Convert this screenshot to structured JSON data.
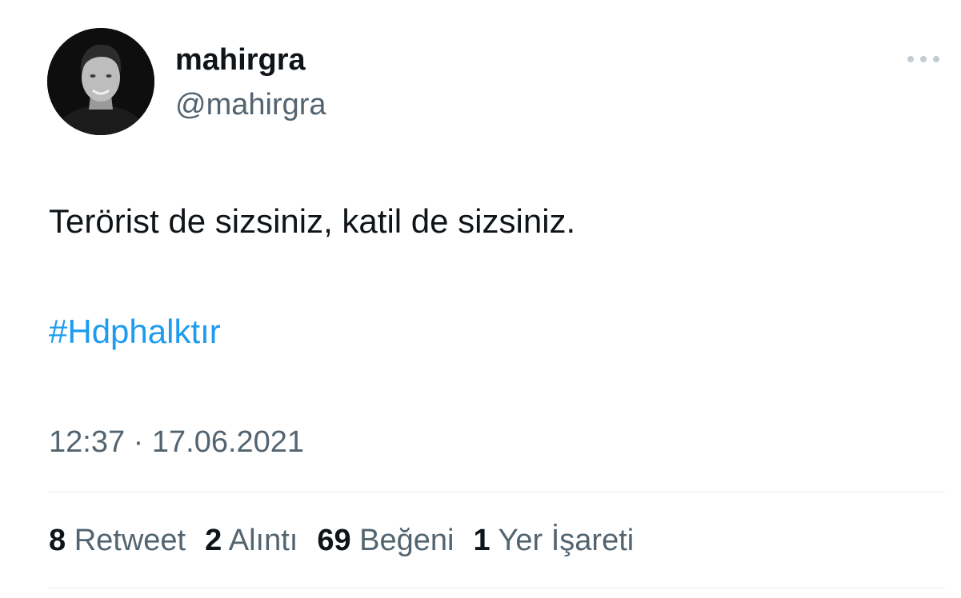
{
  "author": {
    "display_name": "mahirgra",
    "handle": "@mahirgra",
    "avatar_icon": "profile-photo"
  },
  "tweet": {
    "text": "Terörist de sizsiniz, katil de sizsiniz.",
    "hashtag": "#Hdphalktır",
    "timestamp": "12:37 · 17.06.2021"
  },
  "stats": [
    {
      "count": "8",
      "label": "Retweet"
    },
    {
      "count": "2",
      "label": "Alıntı"
    },
    {
      "count": "69",
      "label": "Beğeni"
    },
    {
      "count": "1",
      "label": "Yer İşareti"
    }
  ],
  "colors": {
    "text": "#0f1419",
    "secondary": "#536471",
    "link": "#1d9bf0",
    "divider": "#e1e6ea"
  },
  "icons": {
    "more": "more-horizontal-icon"
  }
}
